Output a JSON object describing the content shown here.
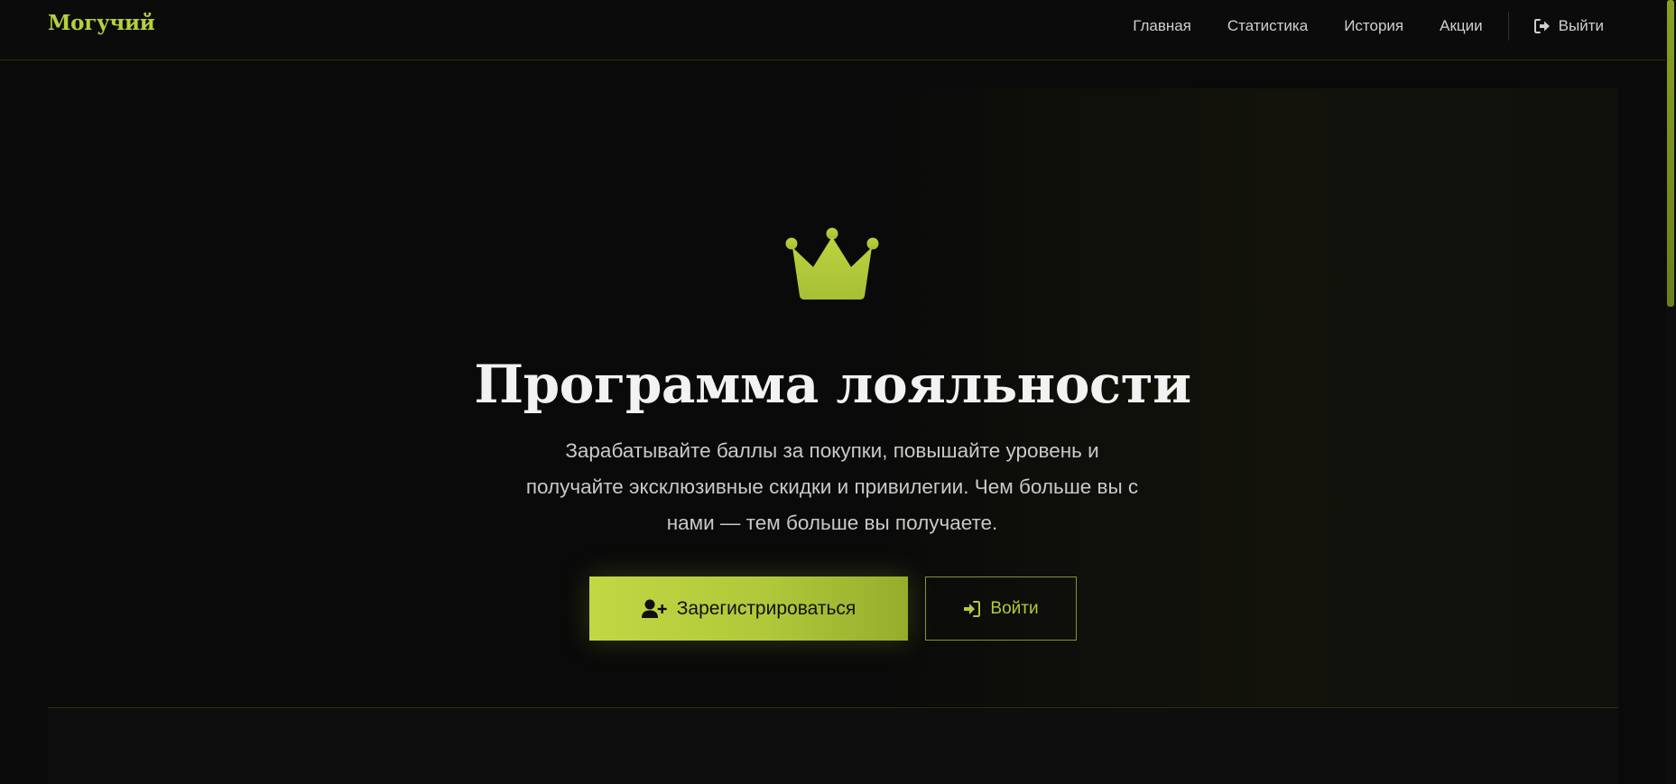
{
  "brand": {
    "logo_text": "Могучий",
    "accent_color": "#b7cf3c"
  },
  "nav": {
    "items": [
      {
        "label": "Главная"
      },
      {
        "label": "Статистика"
      },
      {
        "label": "История"
      },
      {
        "label": "Акции"
      }
    ],
    "logout_label": "Выйти",
    "logout_icon": "logout-icon"
  },
  "hero": {
    "icon": "crown-icon",
    "title": "Программа лояльности",
    "subtitle": "Зарабатывайте баллы за покупки, повышайте уровень и получайте эксклюзивные скидки и привилегии. Чем больше вы с нами — тем больше вы получаете.",
    "register_label": "Зарегистрироваться",
    "register_icon": "user-plus-icon",
    "login_label": "Войти",
    "login_icon": "login-icon"
  }
}
